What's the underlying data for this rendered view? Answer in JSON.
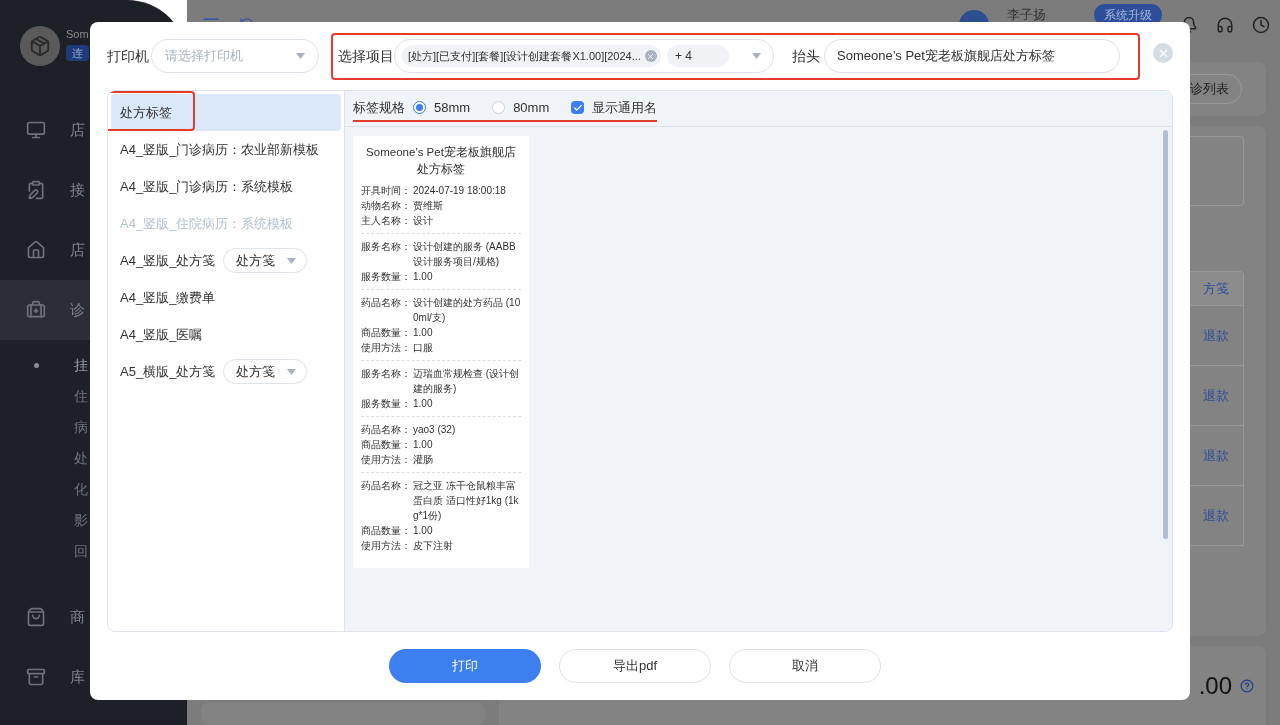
{
  "background": {
    "sidebar": {
      "user_name": "Som",
      "status_badge": "连",
      "nav": [
        {
          "label": "店",
          "selected": false
        },
        {
          "label": "接",
          "selected": false
        },
        {
          "label": "店",
          "selected": false
        },
        {
          "label": "诊",
          "selected": true
        },
        {
          "label": "商",
          "selected": false
        },
        {
          "label": "库",
          "selected": false
        }
      ],
      "sub_items": [
        {
          "label": "挂",
          "selected": true
        },
        {
          "label": "住",
          "selected": false
        },
        {
          "label": "病",
          "selected": false
        },
        {
          "label": "处",
          "selected": false
        },
        {
          "label": "化",
          "selected": false
        },
        {
          "label": "影",
          "selected": false
        },
        {
          "label": "回",
          "selected": false
        }
      ]
    },
    "header": {
      "user": "李子扬",
      "upgrade_button": "系统升级"
    },
    "content": {
      "list_button": "诊列表",
      "column_header": "方笺",
      "row_actions": [
        "退款",
        "退款",
        "退款",
        "退款"
      ],
      "total": ".00"
    }
  },
  "dialog": {
    "printer": {
      "label": "打印机",
      "placeholder": "请选择打印机"
    },
    "items": {
      "label": "选择项目",
      "tag": "[处方][已支付][套餐][设计创建套餐X1.00][2024...",
      "more": "+ 4",
      "highlighted": true
    },
    "heading": {
      "label": "抬头",
      "value": "Someone’s Pet宠老板旗舰店处方标签"
    },
    "templates": [
      {
        "label": "处方标签",
        "selected": true,
        "disabled": false,
        "highlighted": true
      },
      {
        "label": "A4_竖版_门诊病历：农业部新模板",
        "selected": false,
        "disabled": false,
        "highlighted": false
      },
      {
        "label": "A4_竖版_门诊病历：系统模板",
        "selected": false,
        "disabled": false,
        "highlighted": false
      },
      {
        "label": "A4_竖版_住院病历：系统模板",
        "selected": false,
        "disabled": true,
        "highlighted": false
      },
      {
        "label": "A4_竖版_处方笺",
        "selected": false,
        "disabled": false,
        "highlighted": false,
        "dropdown": "处方笺"
      },
      {
        "label": "A4_竖版_缴费单",
        "selected": false,
        "disabled": false,
        "highlighted": false
      },
      {
        "label": "A4_竖版_医嘱",
        "selected": false,
        "disabled": false,
        "highlighted": false
      },
      {
        "label": "A5_横版_处方笺",
        "selected": false,
        "disabled": false,
        "highlighted": false,
        "dropdown": "处方笺"
      }
    ],
    "spec": {
      "label": "标签规格",
      "highlighted": true,
      "options": [
        {
          "label": "58mm",
          "selected": true
        },
        {
          "label": "80mm",
          "selected": false
        }
      ],
      "show_generic": {
        "label": "显示通用名",
        "checked": true
      }
    },
    "preview": {
      "title": [
        "Someone’s Pet宠老板旗舰店",
        "处方标签"
      ],
      "sections": [
        [
          {
            "key": "开具时间：",
            "value": "2024-07-19 18:00:18"
          },
          {
            "key": "动物名称：",
            "value": "贾维斯"
          },
          {
            "key": "主人名称：",
            "value": "设计"
          }
        ],
        [
          {
            "key": "服务名称：",
            "value": "设计创建的服务 (AABB设计服务项目/规格)"
          },
          {
            "key": "服务数量：",
            "value": "1.00"
          }
        ],
        [
          {
            "key": "药品名称：",
            "value": "设计创建的处方药品 (100ml/支)"
          },
          {
            "key": "商品数量：",
            "value": "1.00"
          },
          {
            "key": "使用方法：",
            "value": "口服"
          }
        ],
        [
          {
            "key": "服务名称：",
            "value": "迈瑞血常规检查 (设计创建的服务)"
          },
          {
            "key": "服务数量：",
            "value": "1.00"
          }
        ],
        [
          {
            "key": "药品名称：",
            "value": "yao3 (32)"
          },
          {
            "key": "商品数量：",
            "value": "1.00"
          },
          {
            "key": "使用方法：",
            "value": "灌肠"
          }
        ],
        [
          {
            "key": "药品名称：",
            "value": "冠之亚 冻干仓鼠粮丰富蛋白质 适口性好1kg (1kg*1份)"
          },
          {
            "key": "商品数量：",
            "value": "1.00"
          },
          {
            "key": "使用方法：",
            "value": "皮下注射"
          }
        ]
      ]
    },
    "buttons": [
      {
        "label": "打印",
        "kind": "primary"
      },
      {
        "label": "导出pdf",
        "kind": "default"
      },
      {
        "label": "取消",
        "kind": "default"
      }
    ]
  }
}
